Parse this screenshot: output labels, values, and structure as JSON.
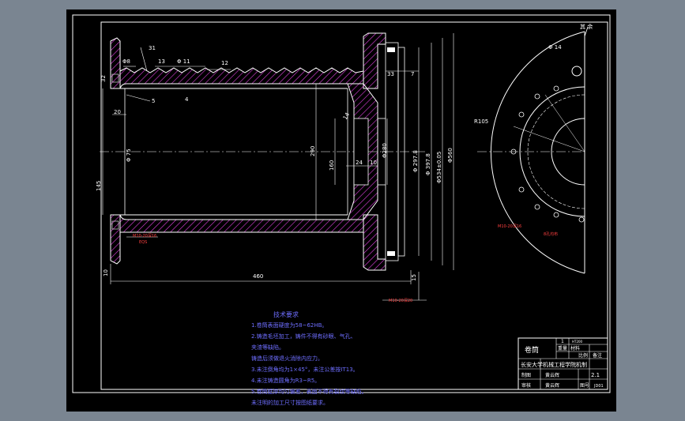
{
  "roughness_mark": "其 余",
  "dims": {
    "d_8": "Φ8",
    "d_31": "31",
    "d_13": "13",
    "d_11": "Φ 11",
    "d_12": "12",
    "d_33": "33",
    "d_7": "7",
    "d_32": "32",
    "d_5": "5",
    "d_4": "4",
    "d_20": "20",
    "d_75": "Φ 75",
    "d_145": "145",
    "d_290": "290",
    "d_160": "160",
    "d_24": "24",
    "d_10": "10",
    "d_14": "14",
    "d_280": "Φ280",
    "d_297": "Φ 297.8",
    "d_397": "Φ 397.8",
    "d_534": "Φ534±0.05",
    "d_560": "Φ560",
    "d_460": "460",
    "d_10b": "10",
    "d_15": "15",
    "d_r105": "R105",
    "d_14b": "Φ 14",
    "thread_left": "M10-20深16",
    "thread_left2": "EQS",
    "thread_bottom": "M10-20深20",
    "thread_right": "M10-20深16",
    "thread_right2": "8孔均布"
  },
  "notes": {
    "title": "技术要求",
    "lines": [
      "1.卷筒表面硬度为58~62HB。",
      "2.铸造毛坯加工，铸件不得有砂眼、气孔、",
      "夹渣等缺陷。",
      "  铸造后须做退火消除内应力。",
      "3.未注倒角均为1×45°，未注公差按IT13。",
      "4.未注铸造圆角为R3~R5。",
      "5.卷筒壁厚均匀偏差，表面不得有裂纹等缺陷。",
      "  未注明的加工尺寸按图纸要求。"
    ]
  },
  "title_block": {
    "part_name": "卷筒",
    "qty": "1",
    "material_label": "材料",
    "material": "HT200",
    "weight_label": "重量",
    "scale_label": "比例",
    "remark": "备注",
    "school": "长安大学机械工程学院机制",
    "drawn_label": "制图",
    "drawn_name": "黄云辉",
    "scale_value": "2.1",
    "check_label": "审核",
    "checker": "黄云辉",
    "drawing_no_label": "图号",
    "drawing_no": "JD01"
  }
}
